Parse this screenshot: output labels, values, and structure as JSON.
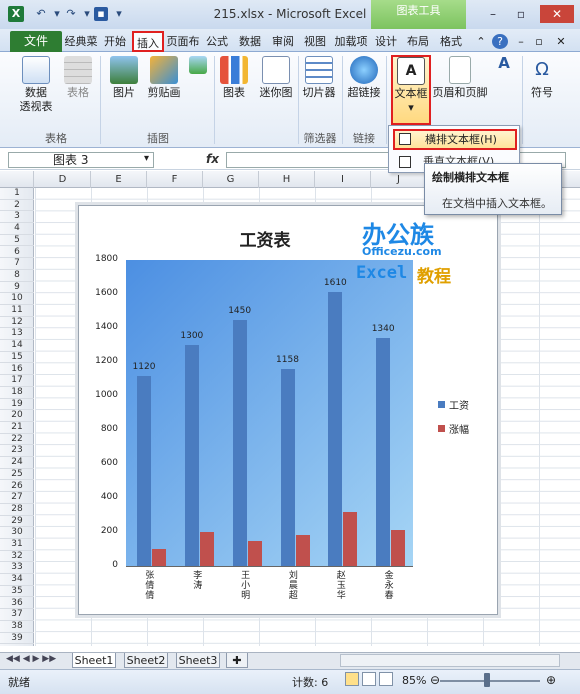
{
  "window": {
    "title": "215.xlsx - Microsoft Excel",
    "context_group": "图表工具"
  },
  "tabs": [
    "文件",
    "经典菜单",
    "开始",
    "插入",
    "页面布局",
    "公式",
    "数据",
    "审阅",
    "视图",
    "加载项",
    "设计",
    "布局",
    "格式"
  ],
  "ribbon": {
    "buttons": [
      "数据\n透视表",
      "表格",
      "图片",
      "剪贴画",
      "图表",
      "迷你图",
      "切片器",
      "超链接",
      "文本框",
      "页眉和页脚",
      "符号"
    ],
    "groups": [
      "表格",
      "插图",
      "筛选器",
      "链接"
    ]
  },
  "formula_bar": {
    "name_box": "图表 3",
    "fx": "fx",
    "value": ""
  },
  "columns": [
    "D",
    "E",
    "F",
    "G",
    "H",
    "I",
    "J"
  ],
  "rows": [
    "1",
    "2",
    "3",
    "4",
    "5",
    "6",
    "7",
    "8",
    "9",
    "10",
    "11",
    "12",
    "13",
    "14",
    "15",
    "16",
    "17",
    "18",
    "19",
    "20",
    "21",
    "22",
    "23",
    "24",
    "25",
    "26",
    "27",
    "28",
    "29",
    "30",
    "31",
    "32",
    "33",
    "34",
    "35",
    "36",
    "37",
    "38",
    "39"
  ],
  "dropdown": {
    "item1": "横排文本框(H)",
    "item2": "垂直文本框(V)"
  },
  "tooltip": {
    "title": "绘制横排文本框",
    "desc": "在文档中插入文本框。"
  },
  "watermark": {
    "line1a": "办公",
    "line1b": "族",
    "line2": "Officezu.com",
    "line3a": "Excel",
    "line3b": "教程"
  },
  "chart_data": {
    "type": "bar",
    "title": "工资表",
    "categories": [
      "张倩倩",
      "李涛",
      "王小明",
      "刘晨超",
      "赵玉华",
      "金永春"
    ],
    "series": [
      {
        "name": "工资",
        "values": [
          1120,
          1300,
          1450,
          1158,
          1610,
          1340
        ],
        "color": "#4a7cc0"
      },
      {
        "name": "涨幅",
        "values": [
          100,
          200,
          150,
          180,
          320,
          210
        ],
        "color": "#c0504d"
      }
    ],
    "ylim": [
      0,
      1800
    ],
    "yticks": [
      0,
      200,
      400,
      600,
      800,
      1000,
      1200,
      1400,
      1600,
      1800
    ],
    "legend": "right"
  },
  "sheets": [
    "Sheet1",
    "Sheet2",
    "Sheet3"
  ],
  "status": {
    "ready": "就绪",
    "count": "计数: 6",
    "zoom": "85%"
  }
}
